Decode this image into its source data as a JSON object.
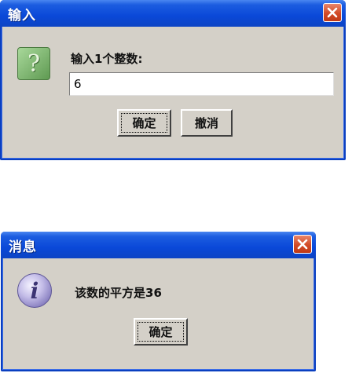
{
  "input_dialog": {
    "title": "输入",
    "prompt": "输入1个整数:",
    "input_value": "6",
    "ok_label": "确定",
    "cancel_label": "撤消",
    "icon": "question-icon"
  },
  "message_dialog": {
    "title": "消息",
    "message": "该数的平方是36",
    "ok_label": "确定",
    "icon": "info-icon"
  },
  "colors": {
    "titlebar": "#0a48d8",
    "dialog_bg": "#d4d0c8",
    "close_button": "#d24a26"
  }
}
